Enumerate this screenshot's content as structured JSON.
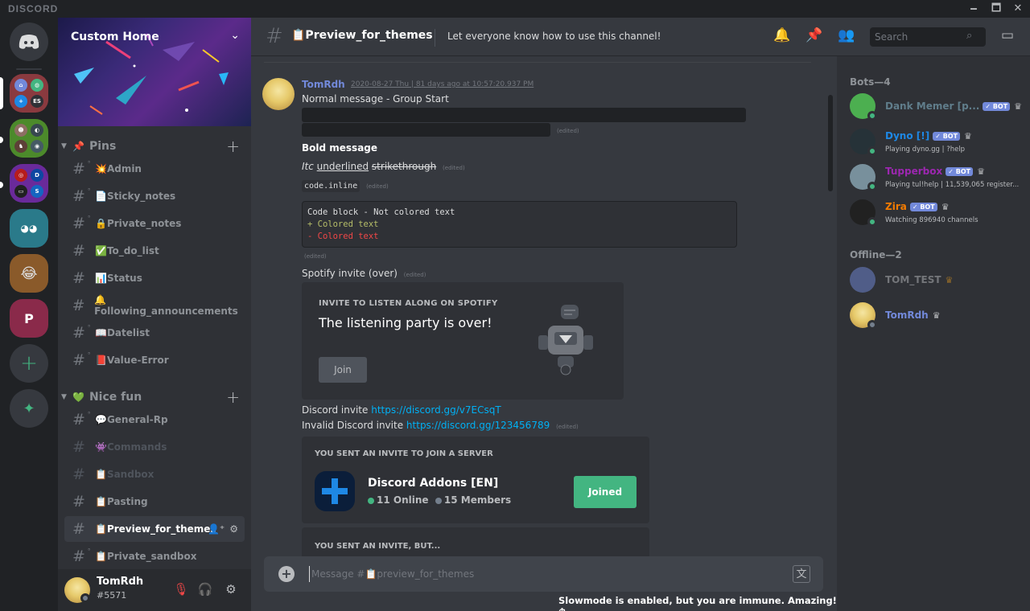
{
  "app": {
    "brand": "DISCORD",
    "minimize": "🗕",
    "maximize": "🗖",
    "close": "✕"
  },
  "servers": [
    {
      "name": "home",
      "glyph": "🎮"
    },
    {
      "name": "folder-1",
      "minis": [
        "⌂",
        "◍",
        "+",
        "ES"
      ]
    },
    {
      "name": "folder-2",
      "minis": [
        "☻",
        "◐",
        "♞",
        "◉"
      ]
    },
    {
      "name": "folder-3",
      "minis": [
        "◎",
        "D",
        "▭",
        "S"
      ]
    },
    {
      "name": "server-4",
      "glyph": "◕◕"
    },
    {
      "name": "server-5",
      "glyph": "😂"
    },
    {
      "name": "server-6",
      "glyph": "P"
    }
  ],
  "rail": {
    "add": "+",
    "explore": "✦"
  },
  "guild": {
    "name": "Custom Home",
    "chevron": "⌄"
  },
  "categories": [
    {
      "label": "Pins",
      "emoji": "📌",
      "add": "+"
    },
    {
      "label": "Nice fun",
      "emoji": "💚",
      "add": "+"
    }
  ],
  "channels_pins": [
    {
      "label": "💥Admin"
    },
    {
      "label": "📄Sticky_notes"
    },
    {
      "label": "🔒Private_notes"
    },
    {
      "label": "✅To_do_list"
    },
    {
      "label": "📊Status"
    },
    {
      "label": "🔔Following_announcements"
    },
    {
      "label": "📖Datelist"
    },
    {
      "label": "📕Value-Error"
    }
  ],
  "channels_fun": [
    {
      "label": "💬General-Rp"
    },
    {
      "label": "👾Commands"
    },
    {
      "label": "📋Sandbox"
    },
    {
      "label": "📋Pasting"
    },
    {
      "label": "📋Preview_for_themes"
    },
    {
      "label": "📋Private_sandbox"
    }
  ],
  "user": {
    "name": "TomRdh",
    "tag": "#5571"
  },
  "header": {
    "channel": "📋Preview_for_themes",
    "topic": "Let everyone know how to use this channel!",
    "search_placeholder": "Search"
  },
  "message": {
    "author": "TomRdh",
    "timestamp": "2020-08-27 Thu | 81 days ago at 10:57:20.937 PM",
    "normal": "Normal message - Group Start",
    "edited": "(edited)",
    "bold": "Bold message",
    "italic": "Itc",
    "underline": "underlined",
    "strike": "strikethrough",
    "inline_code": "code.inline",
    "codeblock": [
      "Code block - Not colored text",
      "+ Colored text",
      "- Colored text"
    ],
    "spotify_label": "Spotify invite (over)",
    "discord_invite_label": "Discord invite",
    "discord_invite_link": "https://discord.gg/v7ECsqT",
    "invalid_label": "Invalid Discord invite",
    "invalid_link": "https://discord.gg/123456789"
  },
  "spotify": {
    "title": "INVITE TO LISTEN ALONG ON SPOTIFY",
    "subtitle": "The listening party is over!",
    "join": "Join"
  },
  "invite": {
    "title": "YOU SENT AN INVITE TO JOIN A SERVER",
    "server": "Discord Addons [EN]",
    "online": "11 Online",
    "members": "15 Members",
    "button": "Joined",
    "title2": "YOU SENT AN INVITE, BUT..."
  },
  "composer": {
    "placeholder": "Message #📋preview_for_themes",
    "slowmode": "Slowmode is enabled, but you are immune. Amazing! ⏱"
  },
  "members_list": {
    "bots_header": "Bots—4",
    "offline_header": "Offline—2",
    "bots": [
      {
        "name": "Dank Memer [p...",
        "color": "#607d8b",
        "activity": ""
      },
      {
        "name": "Dyno [!]",
        "color": "#1e88e5",
        "activity": "Playing dyno.gg | ?help"
      },
      {
        "name": "Tupperbox",
        "color": "#9c27b0",
        "activity": "Playing tul!help | 11,539,065 register..."
      },
      {
        "name": "Zira",
        "color": "#f57c00",
        "activity": "Watching 896940 channels"
      }
    ],
    "offline": [
      {
        "name": "TOM_TEST",
        "color": "#5f6168"
      },
      {
        "name": "TomRdh",
        "color": "#7289da"
      }
    ],
    "bot_tag": "✓ BOT",
    "crown": "♛"
  },
  "colors": {
    "accent": "#7289da",
    "green": "#43b581",
    "link": "#00b0f4",
    "bg": "#36393f"
  }
}
